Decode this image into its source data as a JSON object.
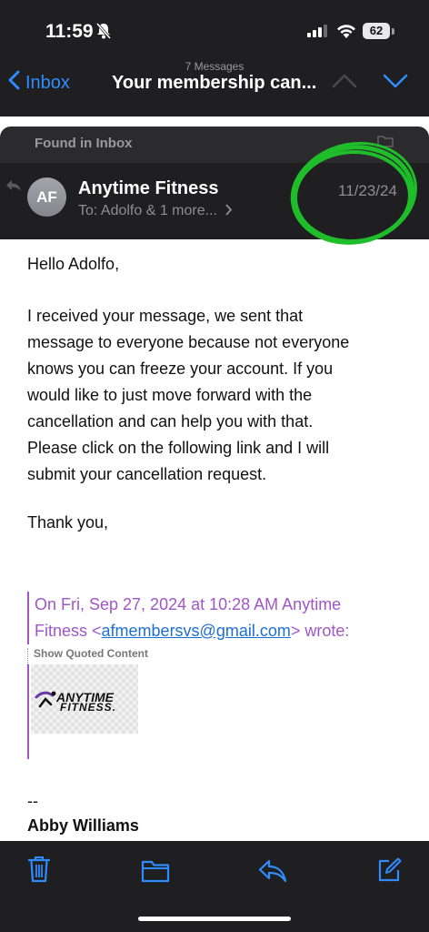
{
  "status_bar": {
    "time": "11:59",
    "battery": "62"
  },
  "nav": {
    "back_label": "Inbox",
    "message_count": "7 Messages",
    "title": "Your membership can..."
  },
  "header": {
    "found_in": "Found in Inbox",
    "avatar_initials": "AF",
    "sender": "Anytime Fitness",
    "to": "To: Adolfo & 1 more...",
    "date": "11/23/24"
  },
  "body": {
    "greeting": "Hello Adolfo,",
    "paragraph_lines": [
      "I received your message, we sent that",
      "message to everyone because not everyone",
      "knows you can freeze your account. If you",
      "would like to just move forward with the",
      "cancellation and can help you with that.",
      "Please click on the following link and I will",
      "submit your cancellation request."
    ],
    "closing": "Thank you,"
  },
  "quote": {
    "line1": "On Fri, Sep 27, 2024 at 10:28 AM Anytime",
    "line2_prefix": "Fitness <",
    "email": "afmembersvs@gmail.com",
    "line2_suffix": "> wrote:",
    "show_quoted": "Show Quoted Content",
    "logo_line1": "ANYTIME",
    "logo_line2": "FITNESS."
  },
  "signature": {
    "dash": "--",
    "name": "Abby Williams"
  },
  "colors": {
    "accent": "#2f8cff",
    "quote": "#a056c7",
    "link": "#1b6fd4",
    "highlight_circle": "#1fbd2a",
    "dark_bg": "#1f1f21"
  },
  "toolbar": {
    "icons": [
      "trash-icon",
      "folder-icon",
      "reply-icon",
      "compose-icon"
    ]
  }
}
